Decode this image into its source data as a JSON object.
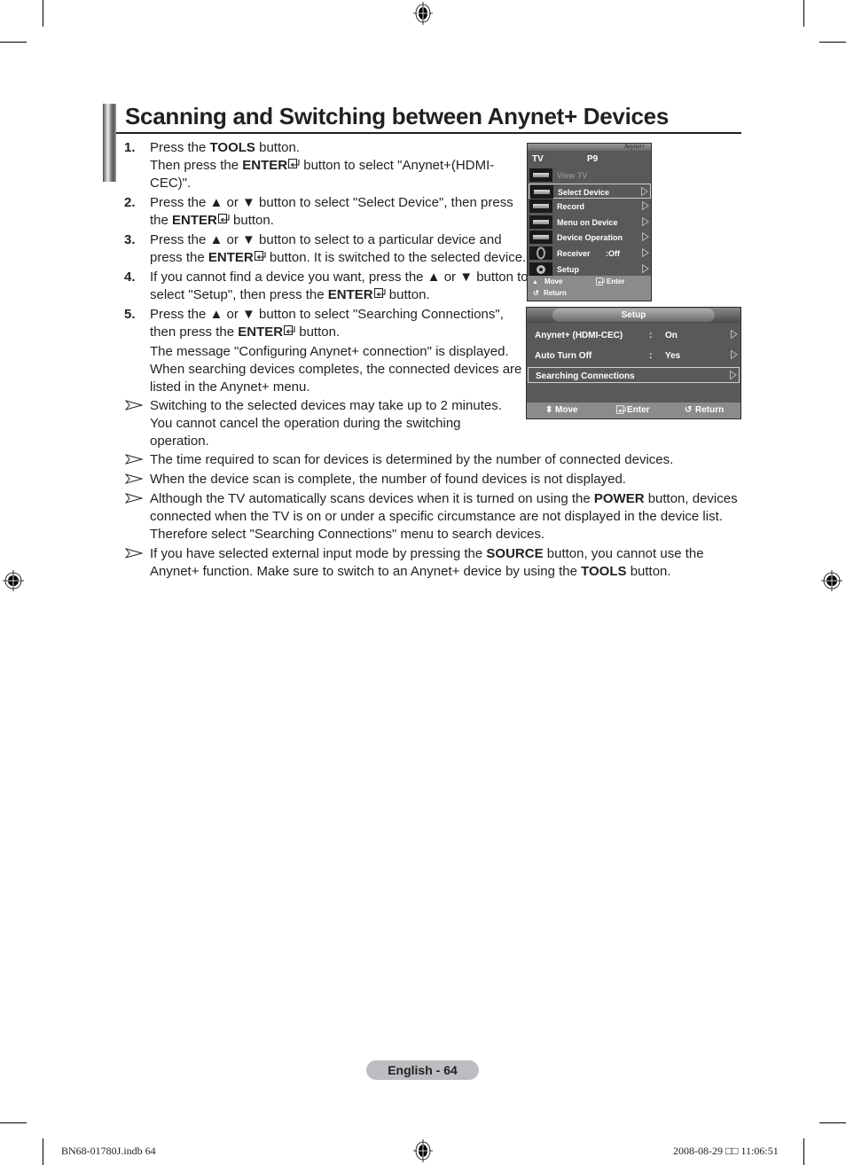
{
  "page": {
    "title": "Scanning and Switching between Anynet+ Devices",
    "steps": [
      {
        "number": "1.",
        "lines": [
          [
            {
              "t": "Press the "
            },
            {
              "t": "TOOLS",
              "b": true
            },
            {
              "t": " button."
            }
          ],
          [
            {
              "t": "Then press the "
            },
            {
              "t": "ENTER",
              "b": true,
              "enter_icon": true
            },
            {
              "t": " button to select \"Anynet+(HDMI-"
            }
          ],
          [
            {
              "t": "CEC)\"."
            }
          ]
        ]
      },
      {
        "number": "2.",
        "lines": [
          [
            {
              "t": "Press the ▲ or ▼ button to select \"Select Device\", then press"
            }
          ],
          [
            {
              "t": "the "
            },
            {
              "t": "ENTER",
              "b": true,
              "enter_icon": true
            },
            {
              "t": " button."
            }
          ]
        ]
      },
      {
        "number": "3.",
        "lines": [
          [
            {
              "t": "Press the ▲ or ▼ button to select to a particular device and"
            }
          ],
          [
            {
              "t": "press the "
            },
            {
              "t": "ENTER",
              "b": true,
              "enter_icon": true
            },
            {
              "t": " button. It is switched to the selected device."
            }
          ]
        ]
      },
      {
        "number": "4.",
        "lines": [
          [
            {
              "t": "If you cannot find a device you want, press the ▲ or ▼ button to"
            }
          ],
          [
            {
              "t": "select \"Setup\", then press the "
            },
            {
              "t": "ENTER",
              "b": true,
              "enter_icon": true
            },
            {
              "t": " button."
            }
          ]
        ]
      },
      {
        "number": "5.",
        "lines": [
          [
            {
              "t": "Press the ▲ or ▼ button to select \"Searching Connections\","
            }
          ],
          [
            {
              "t": "then press the "
            },
            {
              "t": "ENTER",
              "b": true,
              "enter_icon": true
            },
            {
              "t": " button."
            }
          ]
        ]
      }
    ],
    "step5_message": [
      "The message \"Configuring Anynet+ connection\" is displayed.",
      "When searching devices completes, the connected devices are",
      "listed in the Anynet+ menu."
    ],
    "notes": [
      {
        "lines": [
          [
            {
              "t": "Switching to the selected devices may take up to 2 minutes."
            }
          ],
          [
            {
              "t": "You cannot cancel the operation during the switching"
            }
          ],
          [
            {
              "t": "operation."
            }
          ]
        ]
      },
      {
        "lines": [
          [
            {
              "t": "The time required to scan for devices is determined by the number of connected devices."
            }
          ]
        ]
      },
      {
        "lines": [
          [
            {
              "t": "When the device scan is complete, the number of found devices is not displayed."
            }
          ]
        ]
      },
      {
        "lines": [
          [
            {
              "t": "Although the TV automatically scans devices when it is turned on using the "
            },
            {
              "t": "POWER",
              "b": true
            },
            {
              "t": " button, devices"
            }
          ],
          [
            {
              "t": "connected when the TV is on or under a specific circumstance are not displayed in the device list."
            }
          ],
          [
            {
              "t": "Therefore select \"Searching Connections\" menu to search devices."
            }
          ]
        ]
      },
      {
        "lines": [
          [
            {
              "t": "If you have selected external input mode by pressing the "
            },
            {
              "t": "SOURCE",
              "b": true
            },
            {
              "t": " button, you cannot use the"
            }
          ],
          [
            {
              "t": "Anynet+ function. Make sure to switch to an Anynet+ device by using the "
            },
            {
              "t": "TOOLS",
              "b": true
            },
            {
              "t": " button."
            }
          ]
        ]
      }
    ],
    "page_label": "English - 64"
  },
  "tv_menu": {
    "logo": "Anynet+",
    "header_left": "TV",
    "header_right": "P9",
    "items": [
      {
        "label": "View TV",
        "value": "",
        "dimmed": true,
        "arrow": false,
        "icon": "tv-icon"
      },
      {
        "label": "Select Device",
        "value": "",
        "selected": true,
        "arrow": true,
        "icon": "select-device-icon"
      },
      {
        "label": "Record",
        "value": "",
        "arrow": true,
        "icon": "recorder-icon"
      },
      {
        "label": "Menu on Device",
        "value": "",
        "arrow": true,
        "icon": "device-menu-icon"
      },
      {
        "label": "Device Operation",
        "value": "",
        "arrow": true,
        "icon": "device-operation-icon"
      },
      {
        "label": "Receiver",
        "value": ":Off",
        "arrow": true,
        "icon": "speaker-icon"
      },
      {
        "label": "Setup",
        "value": "",
        "arrow": true,
        "icon": "gear-icon"
      }
    ],
    "footer": {
      "move": "Move",
      "enter": "Enter",
      "return": "Return"
    }
  },
  "setup_menu": {
    "title": "Setup",
    "items": [
      {
        "label": "Anynet+ (HDMI-CEC)",
        "sep": ":",
        "value": "On"
      },
      {
        "label": "Auto Turn Off",
        "sep": ":",
        "value": "Yes"
      },
      {
        "label": "Searching Connections",
        "sep": "",
        "value": "",
        "selected": true
      }
    ],
    "footer": {
      "move": "Move",
      "enter": "Enter",
      "return": "Return"
    }
  },
  "slug": {
    "left": "BN68-01780J.indb   64",
    "right": "2008-08-29   □□ 11:06:51"
  },
  "colors": {
    "text": "#231f20",
    "menu_bg": "#58595b",
    "menu_footer": "#8a8b8d",
    "page_pill": "#bcbdc0"
  }
}
